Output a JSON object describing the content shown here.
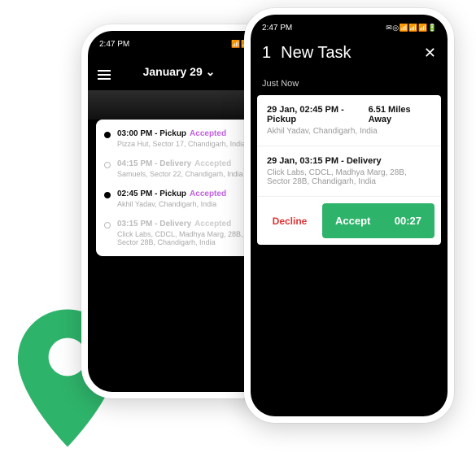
{
  "statusbar": {
    "time": "2:47 PM"
  },
  "pin_color": "#2eb36a",
  "phone1": {
    "header": {
      "title": "January 29"
    },
    "tasks": [
      {
        "filled": true,
        "time": "03:00 PM",
        "type": "Pickup",
        "status": "Accepted",
        "muted": false,
        "sub": "Pizza Hut, Sector 17, Chandigarh, India"
      },
      {
        "filled": false,
        "time": "04:15 PM",
        "type": "Delivery",
        "status": "Accepted",
        "muted": true,
        "sub": "Samuels, Sector 22, Chandigarh, India"
      },
      {
        "filled": true,
        "time": "02:45 PM",
        "type": "Pickup",
        "status": "Accepted",
        "muted": false,
        "sub": "Akhil Yadav, Chandigarh, India"
      },
      {
        "filled": false,
        "time": "03:15 PM",
        "type": "Delivery",
        "status": "Accepted",
        "muted": true,
        "sub": "Click Labs, CDCL, Madhya Marg, 28B, Sector 28B, Chandigarh, India"
      }
    ]
  },
  "phone2": {
    "header": {
      "count": "1",
      "title": "New Task"
    },
    "justnow": "Just Now",
    "pickup": {
      "title": "29 Jan, 02:45 PM - Pickup",
      "distance": "6.51 Miles Away",
      "sub": "Akhil Yadav, Chandigarh, India"
    },
    "delivery": {
      "title": "29 Jan, 03:15 PM - Delivery",
      "sub": "Click Labs, CDCL, Madhya Marg, 28B, Sector 28B, Chandigarh, India"
    },
    "decline": "Decline",
    "accept": "Accept",
    "countdown": "00:27"
  }
}
